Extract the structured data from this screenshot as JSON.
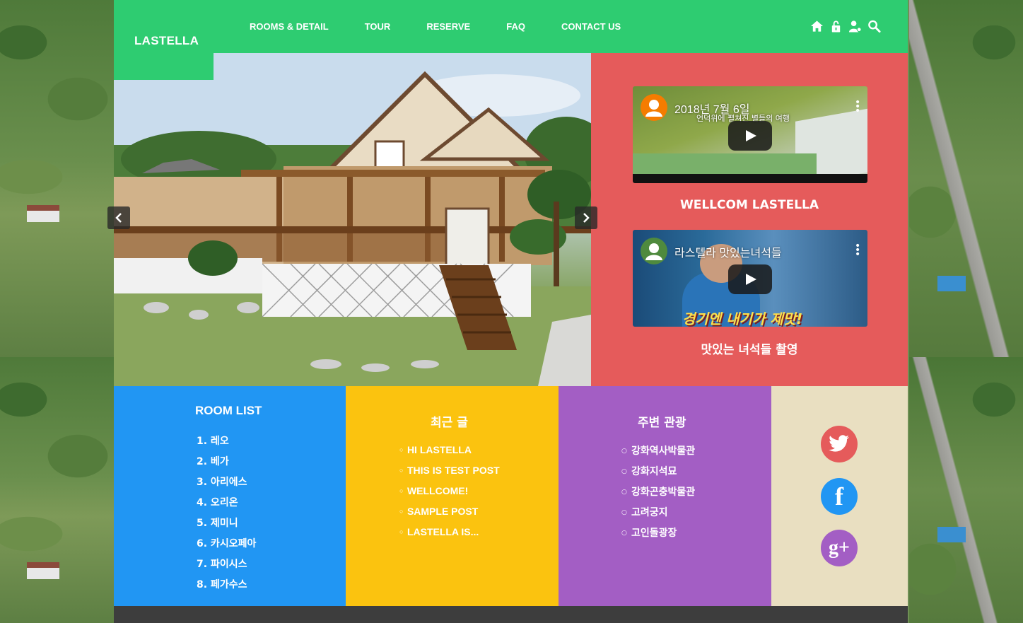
{
  "header": {
    "logo": "LASTELLA",
    "nav": [
      {
        "label": "ROOMS & DETAIL"
      },
      {
        "label": "TOUR"
      },
      {
        "label": "RESERVE"
      },
      {
        "label": "FAQ"
      },
      {
        "label": "CONTACT US"
      }
    ],
    "icons": [
      "home-icon",
      "lock-icon",
      "user-icon",
      "search-icon"
    ]
  },
  "slider": {
    "prev_label": "‹",
    "next_label": "›"
  },
  "videos": [
    {
      "title": "2018년 7월 6일",
      "subtitle": "언덕위에 펼쳐진 별들의 여행",
      "caption": "WELLCOM LASTELLA"
    },
    {
      "title": "라스텔라 맛있는녀석들",
      "subtitle": "경기엔 내기가 제맛!",
      "caption": "맛있는 녀석들 촬영"
    }
  ],
  "rooms": {
    "title": "ROOM LIST",
    "items": [
      "1. 레오",
      "2. 베가",
      "3. 아리에스",
      "4. 오리온",
      "5. 제미니",
      "6. 카시오페아",
      "7. 파이시스",
      "8. 페가수스"
    ]
  },
  "recent": {
    "title": "최근 글",
    "items": [
      "HI LASTELLA",
      "THIS IS TEST POST",
      "WELLCOME!",
      "SAMPLE POST",
      "LASTELLA IS..."
    ]
  },
  "tour": {
    "title": "주변 관광",
    "items": [
      "강화역사박물관",
      "강화지석묘",
      "강화곤충박물관",
      "고려궁지",
      "고인돌광장"
    ]
  },
  "social": {
    "twitter": {
      "color": "#e55b5b",
      "icon": "twitter-icon"
    },
    "facebook": {
      "color": "#2196f3",
      "icon": "facebook-icon",
      "glyph": "f"
    },
    "google": {
      "color": "#a35ec4",
      "icon": "google-plus-icon",
      "glyph": "g+"
    }
  },
  "colors": {
    "header_green": "#2ecc71",
    "video_red": "#e55b5b",
    "rooms_blue": "#2196f3",
    "recent_yellow": "#fbc30f",
    "tour_purple": "#a35ec4",
    "social_beige": "#e9dfc1",
    "footer_dark": "#3d3d3d"
  }
}
